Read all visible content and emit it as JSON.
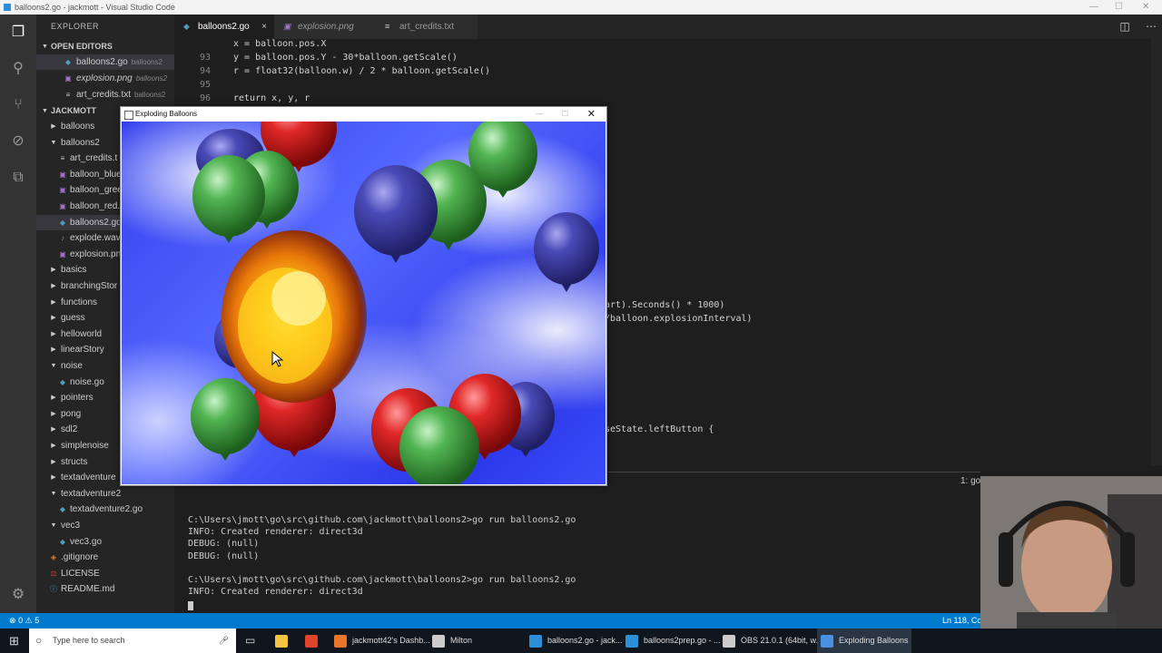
{
  "window": {
    "title": "balloons2.go - jackmott - Visual Studio Code"
  },
  "sidebar": {
    "header": "EXPLORER",
    "open_editors_title": "OPEN EDITORS",
    "open_editors": [
      {
        "label": "balloons2.go",
        "sub": "balloons2",
        "icon": "go-file-icon",
        "color": "#519aba"
      },
      {
        "label": "explosion.png",
        "sub": "balloons2",
        "icon": "image-file-icon",
        "color": "#a074c4"
      },
      {
        "label": "art_credits.txt",
        "sub": "balloons2",
        "icon": "text-file-icon",
        "color": "#cccccc"
      }
    ],
    "project_title": "JACKMOTT",
    "tree": [
      {
        "label": "balloons",
        "depth": 1,
        "type": "folder-closed"
      },
      {
        "label": "balloons2",
        "depth": 1,
        "type": "folder-open"
      },
      {
        "label": "art_credits.t",
        "depth": 2,
        "type": "text"
      },
      {
        "label": "balloon_blue",
        "depth": 2,
        "type": "image"
      },
      {
        "label": "balloon_gree",
        "depth": 2,
        "type": "image"
      },
      {
        "label": "balloon_red.",
        "depth": 2,
        "type": "image"
      },
      {
        "label": "balloons2.go",
        "depth": 2,
        "type": "go",
        "selected": true
      },
      {
        "label": "explode.wav",
        "depth": 2,
        "type": "audio"
      },
      {
        "label": "explosion.pn",
        "depth": 2,
        "type": "image"
      },
      {
        "label": "basics",
        "depth": 1,
        "type": "folder-closed"
      },
      {
        "label": "branchingStor",
        "depth": 1,
        "type": "folder-closed"
      },
      {
        "label": "functions",
        "depth": 1,
        "type": "folder-closed"
      },
      {
        "label": "guess",
        "depth": 1,
        "type": "folder-closed"
      },
      {
        "label": "helloworld",
        "depth": 1,
        "type": "folder-closed"
      },
      {
        "label": "linearStory",
        "depth": 1,
        "type": "folder-closed"
      },
      {
        "label": "noise",
        "depth": 1,
        "type": "folder-open"
      },
      {
        "label": "noise.go",
        "depth": 2,
        "type": "go"
      },
      {
        "label": "pointers",
        "depth": 1,
        "type": "folder-closed"
      },
      {
        "label": "pong",
        "depth": 1,
        "type": "folder-closed"
      },
      {
        "label": "sdl2",
        "depth": 1,
        "type": "folder-closed"
      },
      {
        "label": "simplenoise",
        "depth": 1,
        "type": "folder-closed"
      },
      {
        "label": "structs",
        "depth": 1,
        "type": "folder-closed"
      },
      {
        "label": "textadventure",
        "depth": 1,
        "type": "folder-closed"
      },
      {
        "label": "textadventure2",
        "depth": 1,
        "type": "folder-open"
      },
      {
        "label": "textadventure2.go",
        "depth": 2,
        "type": "go"
      },
      {
        "label": "vec3",
        "depth": 1,
        "type": "folder-open"
      },
      {
        "label": "vec3.go",
        "depth": 2,
        "type": "go"
      },
      {
        "label": ".gitignore",
        "depth": 1,
        "type": "git"
      },
      {
        "label": "LICENSE",
        "depth": 1,
        "type": "license"
      },
      {
        "label": "README.md",
        "depth": 1,
        "type": "markdown"
      }
    ]
  },
  "tabs": [
    {
      "label": "balloons2.go",
      "active": true,
      "close": "×"
    },
    {
      "label": "explosion.png",
      "active": false
    },
    {
      "label": "art_credits.txt",
      "active": false
    }
  ],
  "editor": {
    "lines": [
      {
        "num": "",
        "code": "x = balloon.pos.X"
      },
      {
        "num": "93",
        "code": "y = balloon.pos.Y - 30*balloon.getScale()"
      },
      {
        "num": "94",
        "code": "r = float32(balloon.w) / 2 * balloon.getScale()"
      },
      {
        "num": "95",
        "code": ""
      },
      {
        "num": "96",
        "code": "return x, y, r"
      }
    ],
    "right_fragments": [
      "art).Seconds() * 1000)",
      "/balloon.explosionInterval)",
      "seState.leftButton {"
    ]
  },
  "terminal": {
    "selector": "1: go",
    "lines": [
      "C:\\Users\\jmott\\go\\src\\github.com\\jackmott\\balloons2>go run balloons2.go",
      "INFO: Created renderer: direct3d",
      "DEBUG: (null)",
      "DEBUG: (null)",
      "",
      "C:\\Users\\jmott\\go\\src\\github.com\\jackmott\\balloons2>go run balloons2.go",
      "INFO: Created renderer: direct3d"
    ]
  },
  "status": {
    "errors": "0",
    "warnings": "5",
    "position": "Ln 118, Co"
  },
  "game": {
    "title": "Exploding Balloons",
    "balloons": [
      {
        "color": "red",
        "hex": "#d41c1c"
      },
      {
        "color": "blue",
        "hex": "#3c3ca8"
      },
      {
        "color": "green",
        "hex": "#46a846"
      }
    ]
  },
  "taskbar": {
    "search_placeholder": "Type here to search",
    "items": [
      {
        "label": "jackmott42's Dashb...",
        "icon": "browser-icon",
        "color": "#e8762b"
      },
      {
        "label": "Milton",
        "icon": "app-icon",
        "color": "#cccccc"
      },
      {
        "label": "balloons2.go - jack...",
        "icon": "vscode-icon",
        "color": "#2d8fd8"
      },
      {
        "label": "balloons2prep.go - ...",
        "icon": "vscode-icon",
        "color": "#2d8fd8"
      },
      {
        "label": "OBS 21.0.1 (64bit, w...",
        "icon": "obs-icon",
        "color": "#cccccc"
      },
      {
        "label": "Exploding Balloons",
        "icon": "sdl-window-icon",
        "color": "#4a90e2"
      }
    ]
  }
}
